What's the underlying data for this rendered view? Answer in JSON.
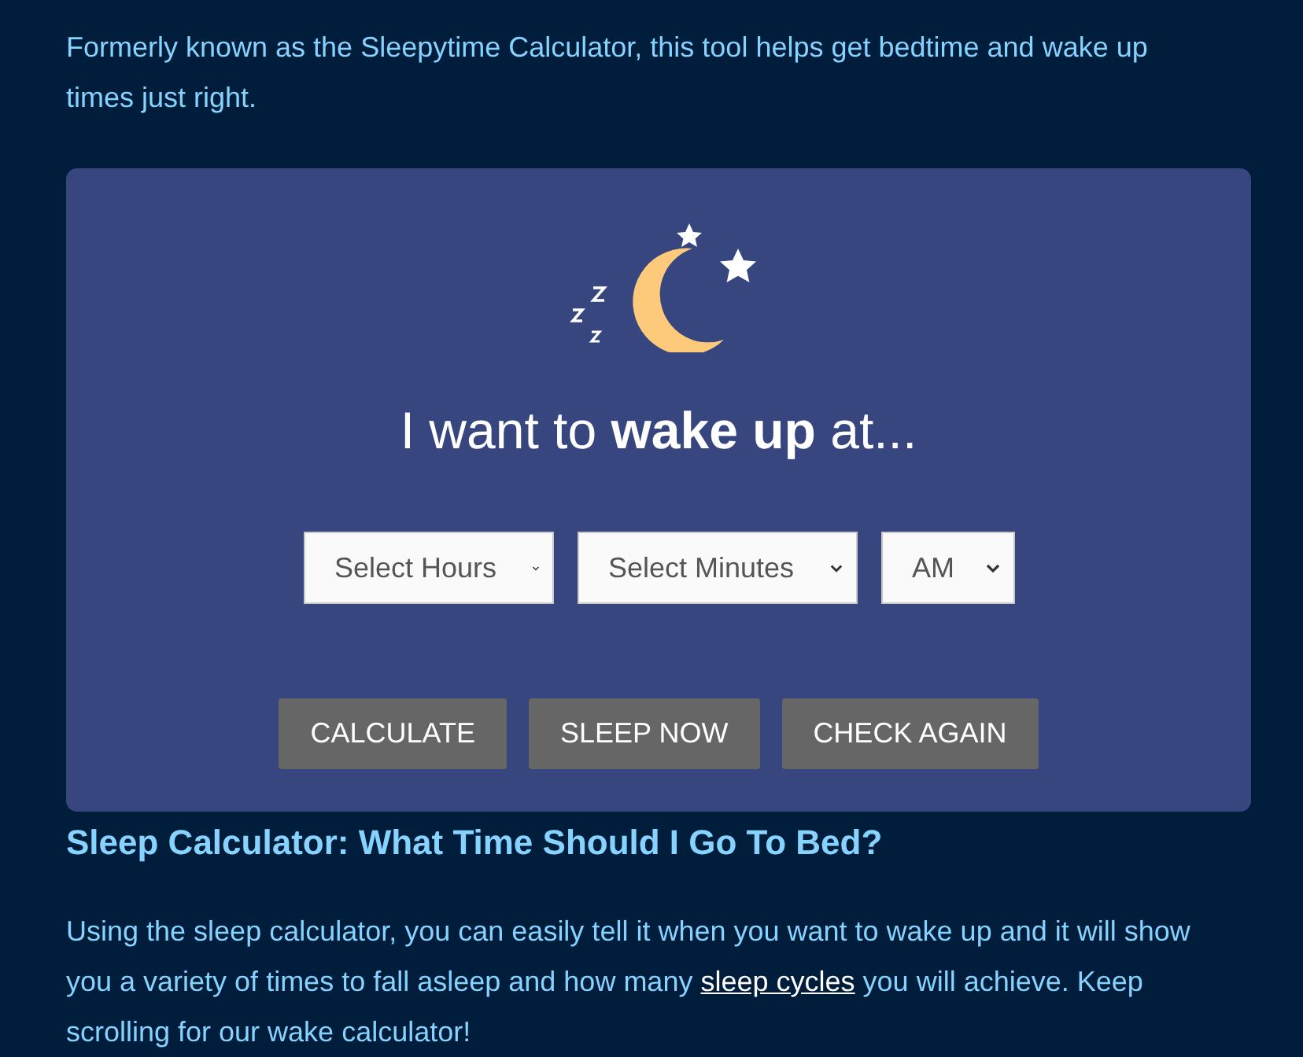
{
  "intro": "Formerly known as the Sleepytime Calculator, this tool helps get bedtime and wake up times just right.",
  "calculator": {
    "heading": "I want to **wake up** at...",
    "selects": [
      {
        "kind": "hours",
        "value": "Select Hours"
      },
      {
        "kind": "minutes",
        "value": "Select Minutes"
      },
      {
        "kind": "period",
        "value": "AM"
      }
    ],
    "buttons": [
      "CALCULATE",
      "SLEEP NOW",
      "CHECK AGAIN"
    ]
  },
  "section": {
    "heading": "Sleep Calculator: What Time Should I Go To Bed?",
    "paragraph": {
      "before": "Using the sleep calculator, you can easily tell it when you want to wake up and it will show you a variety of times to fall asleep and how many",
      "link": "sleep cycles",
      "after": "you will achieve. Keep scrolling for our wake calculator!"
    }
  }
}
